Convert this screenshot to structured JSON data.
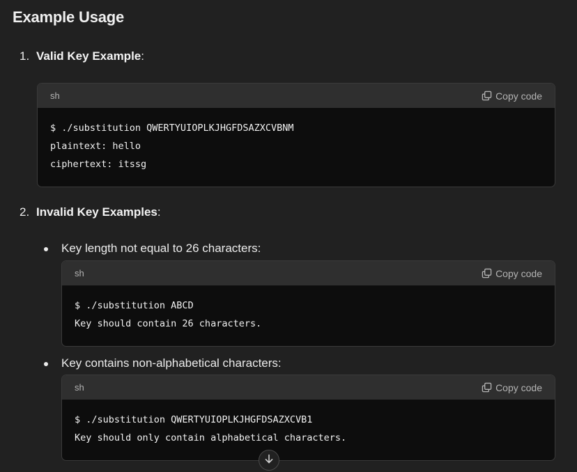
{
  "heading": "Example Usage",
  "items": [
    {
      "number": "1.",
      "title": "Valid Key Example",
      "suffix": ":",
      "code": {
        "lang": "sh",
        "copy_label": "Copy code",
        "lines": [
          "$ ./substitution QWERTYUIOPLKJHGFDSAZXCVBNM",
          "plaintext: hello",
          "ciphertext: itssg"
        ]
      }
    },
    {
      "number": "2.",
      "title": "Invalid Key Examples",
      "suffix": ":",
      "bullets": [
        {
          "text": "Key length not equal to 26 characters:",
          "code": {
            "lang": "sh",
            "copy_label": "Copy code",
            "lines": [
              "$ ./substitution ABCD",
              "Key should contain 26 characters."
            ]
          }
        },
        {
          "text": "Key contains non-alphabetical characters:",
          "code": {
            "lang": "sh",
            "copy_label": "Copy code",
            "lines": [
              "$ ./substitution QWERTYUIOPLKJHGFDSAZXCVB1",
              "Key should only contain alphabetical characters."
            ]
          }
        }
      ]
    }
  ],
  "icons": {
    "copy": "copy-icon",
    "scroll_down": "arrow-down-icon"
  }
}
